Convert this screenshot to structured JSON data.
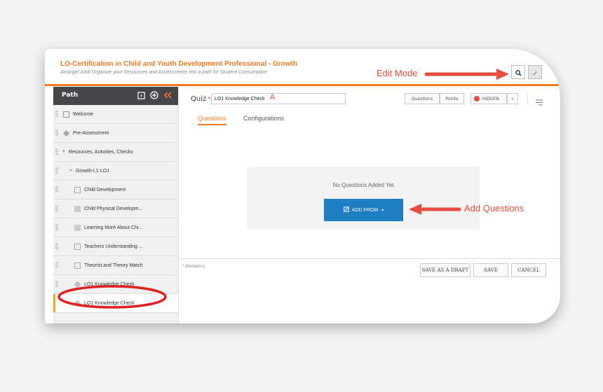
{
  "header": {
    "course_title": "LO-Certification in Child and Youth Development Professional - Growth",
    "course_subtitle": "Arrange/ Add/ Organize your Resources and Assessments into a path for Student Consumption"
  },
  "sidebar": {
    "title": "Path",
    "items": [
      {
        "label": "Welcome"
      },
      {
        "label": "Pre-Assessment"
      },
      {
        "label": "Resources, Activities, Checks"
      },
      {
        "label": "Growth-L1-LO1"
      },
      {
        "label": "Child Development"
      },
      {
        "label": "Child Physical Developm..."
      },
      {
        "label": "Learning More About Chi..."
      },
      {
        "label": "Teachers Understanding ..."
      },
      {
        "label": "Theorist and Theory Match"
      },
      {
        "label": "LO1 Knowledge Check"
      },
      {
        "label": "LO1 Knowledge Check"
      }
    ]
  },
  "main": {
    "quiz_label": "Quiz",
    "quiz_required": "*",
    "quiz_name_value": "LO1 Knowledge Check",
    "quiz_name_mark": "A",
    "toggle_questions": "Questions",
    "toggle_points": "Points",
    "hidden_label": "HIDDEN",
    "tabs": [
      {
        "label": "Questions"
      },
      {
        "label": "Configurations"
      }
    ],
    "empty_text": "No Questions Added Yet",
    "add_from_label": "ADD FROM"
  },
  "footer": {
    "mandatory_star": "*",
    "mandatory_label": "Mandatory",
    "save_draft": "SAVE AS A DRAFT",
    "save": "SAVE",
    "cancel": "CANCEL"
  },
  "annotations": {
    "edit_mode": "Edit Mode",
    "add_questions": "Add Questions"
  },
  "colors": {
    "accent": "#f07a24",
    "primary_button": "#1f7dc1",
    "annotation": "#e74c3c",
    "sidebar_header": "#45464a"
  }
}
